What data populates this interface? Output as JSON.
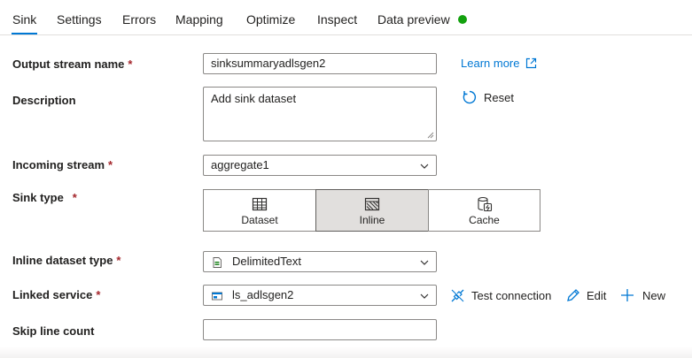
{
  "tabs": [
    {
      "label": "Sink"
    },
    {
      "label": "Settings"
    },
    {
      "label": "Errors"
    },
    {
      "label": "Mapping"
    },
    {
      "label": "Optimize"
    },
    {
      "label": "Inspect"
    },
    {
      "label": "Data preview"
    }
  ],
  "status_color": "#13a10e",
  "accent_color": "#0078d4",
  "required_marker": "*",
  "fields": {
    "output_stream_name": {
      "label": "Output stream name",
      "value": "sinksummaryadlsgen2"
    },
    "description": {
      "label": "Description",
      "value": "Add sink dataset"
    },
    "incoming_stream": {
      "label": "Incoming stream",
      "value": "aggregate1"
    },
    "sink_type": {
      "label": "Sink type",
      "options": [
        "Dataset",
        "Inline",
        "Cache"
      ],
      "selected": "Inline"
    },
    "inline_dataset_type": {
      "label": "Inline dataset type",
      "value": "DelimitedText",
      "icon": "delimited-text-icon"
    },
    "linked_service": {
      "label": "Linked service",
      "value": "ls_adlsgen2",
      "icon": "adls-gen2-icon"
    },
    "skip_line_count": {
      "label": "Skip line count",
      "value": ""
    }
  },
  "links": {
    "learn_more": "Learn more",
    "reset": "Reset",
    "test_connection": "Test connection",
    "edit": "Edit",
    "new": "New"
  }
}
